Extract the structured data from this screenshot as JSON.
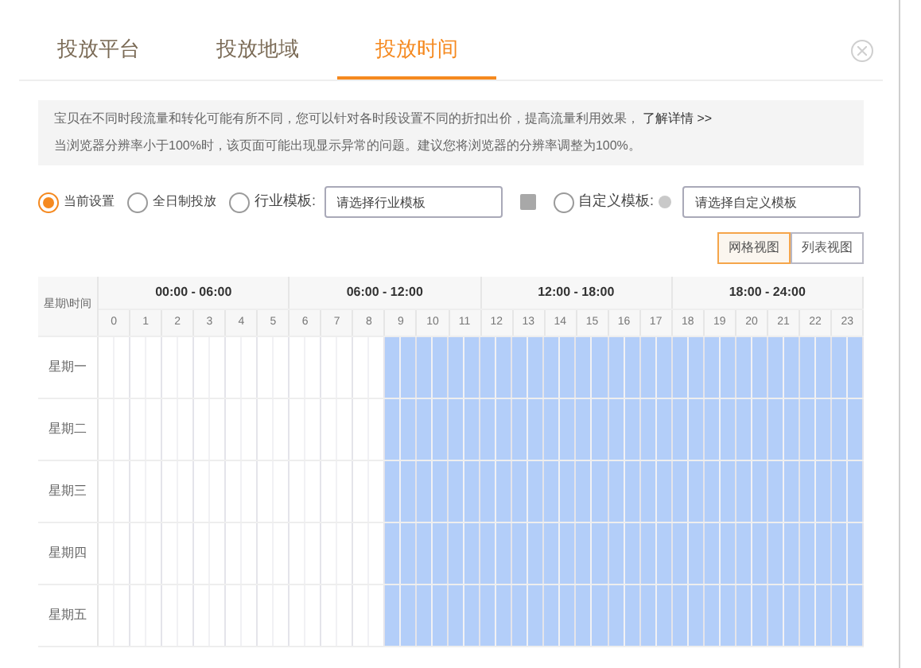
{
  "tabs": [
    {
      "label": "投放平台",
      "selected": false
    },
    {
      "label": "投放地域",
      "selected": false
    },
    {
      "label": "投放时间",
      "selected": true
    }
  ],
  "notice": {
    "line_1": "宝贝在不同时段流量和转化可能有所不同，您可以针对各时段设置不同的折扣出价，提高流量利用效果，",
    "link": "了解详情 >>",
    "line_2": "当浏览器分辨率小于100%时，该页面可能出现显示异常的问题。建议您将浏览器的分辨率调整为100%。"
  },
  "options": [
    {
      "kind": "radio",
      "label": "当前设置",
      "selected": true
    },
    {
      "kind": "radio",
      "label": "全日制投放",
      "selected": false
    },
    {
      "kind": "template",
      "label": "行业模板:",
      "selected": false,
      "placeholder": "请选择行业模板"
    },
    {
      "kind": "custom",
      "label": "自定义模板:",
      "selected": false,
      "placeholder": "请选择自定义模板"
    }
  ],
  "views": [
    {
      "label": "网格视图",
      "selected": true
    },
    {
      "label": "列表视图",
      "selected": false
    }
  ],
  "table": {
    "corner": "星期\\时间",
    "periods": [
      "00:00 - 06:00",
      "06:00 - 12:00",
      "12:00 - 18:00",
      "18:00 - 24:00"
    ],
    "hours": [
      "0",
      "1",
      "2",
      "3",
      "4",
      "5",
      "6",
      "7",
      "8",
      "9",
      "10",
      "11",
      "12",
      "13",
      "14",
      "15",
      "16",
      "17",
      "18",
      "19",
      "20",
      "21",
      "22",
      "23"
    ],
    "rows": [
      {
        "day": "星期一",
        "slots": [
          false,
          false,
          false,
          false,
          false,
          false,
          false,
          false,
          false,
          false,
          false,
          false,
          false,
          false,
          false,
          false,
          false,
          false,
          true,
          true,
          true,
          true,
          true,
          true,
          true,
          true,
          true,
          true,
          true,
          true,
          true,
          true,
          true,
          true,
          true,
          true,
          true,
          true,
          true,
          true,
          true,
          true,
          true,
          true,
          true,
          true,
          true,
          true
        ]
      },
      {
        "day": "星期二",
        "slots": [
          false,
          false,
          false,
          false,
          false,
          false,
          false,
          false,
          false,
          false,
          false,
          false,
          false,
          false,
          false,
          false,
          false,
          false,
          true,
          true,
          true,
          true,
          true,
          true,
          true,
          true,
          true,
          true,
          true,
          true,
          true,
          true,
          true,
          true,
          true,
          true,
          true,
          true,
          true,
          true,
          true,
          true,
          true,
          true,
          true,
          true,
          true,
          true
        ]
      },
      {
        "day": "星期三",
        "slots": [
          false,
          false,
          false,
          false,
          false,
          false,
          false,
          false,
          false,
          false,
          false,
          false,
          false,
          false,
          false,
          false,
          false,
          false,
          true,
          true,
          true,
          true,
          true,
          true,
          true,
          true,
          true,
          true,
          true,
          true,
          true,
          true,
          true,
          true,
          true,
          true,
          true,
          true,
          true,
          true,
          true,
          true,
          true,
          true,
          true,
          true,
          true,
          true
        ]
      },
      {
        "day": "星期四",
        "slots": [
          false,
          false,
          false,
          false,
          false,
          false,
          false,
          false,
          false,
          false,
          false,
          false,
          false,
          false,
          false,
          false,
          false,
          false,
          true,
          true,
          true,
          true,
          true,
          true,
          true,
          true,
          true,
          true,
          true,
          true,
          true,
          true,
          true,
          true,
          true,
          true,
          true,
          true,
          true,
          true,
          true,
          true,
          true,
          true,
          true,
          true,
          true,
          true
        ]
      },
      {
        "day": "星期五",
        "slots": [
          false,
          false,
          false,
          false,
          false,
          false,
          false,
          false,
          false,
          false,
          false,
          false,
          false,
          false,
          false,
          false,
          false,
          false,
          true,
          true,
          true,
          true,
          true,
          true,
          true,
          true,
          true,
          true,
          true,
          true,
          true,
          true,
          true,
          true,
          true,
          true,
          true,
          true,
          true,
          true,
          true,
          true,
          true,
          true,
          true,
          true,
          true,
          true
        ]
      }
    ]
  }
}
